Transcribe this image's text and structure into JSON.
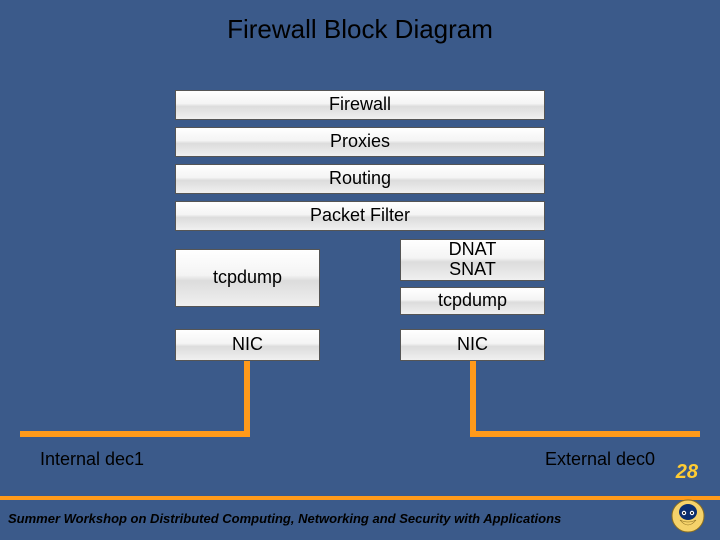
{
  "title": "Firewall Block Diagram",
  "blocks": {
    "firewall": "Firewall",
    "proxies": "Proxies",
    "routing": "Routing",
    "packet_filter": "Packet Filter",
    "tcpdump_left": "tcpdump",
    "dnat_line1": "DNAT",
    "dnat_line2": "SNAT",
    "tcpdump_right": "tcpdump",
    "nic_left": "NIC",
    "nic_right": "NIC"
  },
  "networks": {
    "internal": "Internal dec1",
    "external": "External dec0"
  },
  "slide_number": "28",
  "footer": "Summer Workshop on Distributed Computing, Networking and Security with Applications",
  "colors": {
    "background": "#3b5a8a",
    "wire": "#ff9a1a",
    "slide_num": "#ffcc33"
  }
}
